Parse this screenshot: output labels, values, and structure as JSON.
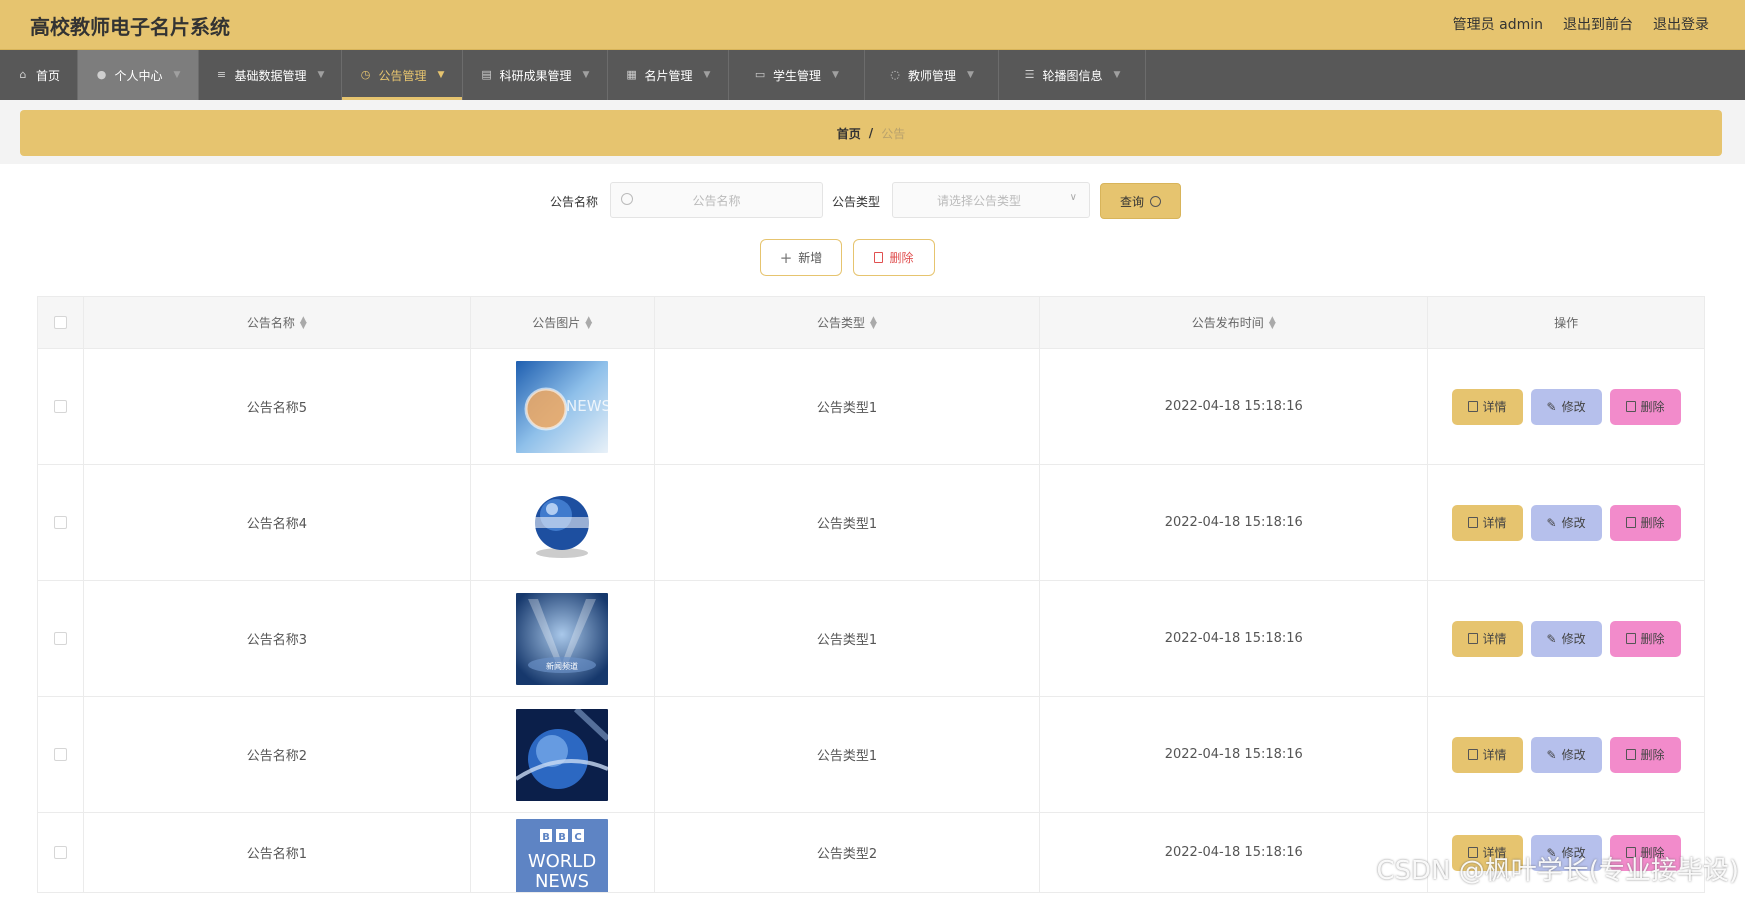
{
  "app": {
    "title": "高校教师电子名片系统"
  },
  "top_links": {
    "admin": "管理员 admin",
    "front": "退出到前台",
    "logout": "退出登录"
  },
  "nav": [
    {
      "label": "首页",
      "icon": "home-icon"
    },
    {
      "label": "个人中心",
      "icon": "user-icon"
    },
    {
      "label": "基础数据管理",
      "icon": "grid-icon"
    },
    {
      "label": "公告管理",
      "icon": "clock-icon"
    },
    {
      "label": "科研成果管理",
      "icon": "printer-icon"
    },
    {
      "label": "名片管理",
      "icon": "apps-icon"
    },
    {
      "label": "学生管理",
      "icon": "card-icon"
    },
    {
      "label": "教师管理",
      "icon": "power-icon"
    },
    {
      "label": "轮播图信息",
      "icon": "list-icon"
    }
  ],
  "breadcrumb": {
    "home": "首页",
    "sep": "/",
    "current": "公告"
  },
  "search": {
    "name_label": "公告名称",
    "name_placeholder": "公告名称",
    "type_label": "公告类型",
    "type_placeholder": "请选择公告类型",
    "query_label": "查询"
  },
  "actions": {
    "add_label": "新增",
    "delete_label": "删除"
  },
  "table": {
    "headers": [
      "公告名称",
      "公告图片",
      "公告类型",
      "公告发布时间",
      "操作"
    ],
    "rows": [
      {
        "name": "公告名称5",
        "type": "公告类型1",
        "time": "2022-04-18 15:18:16"
      },
      {
        "name": "公告名称4",
        "type": "公告类型1",
        "time": "2022-04-18 15:18:16"
      },
      {
        "name": "公告名称3",
        "type": "公告类型1",
        "time": "2022-04-18 15:18:16"
      },
      {
        "name": "公告名称2",
        "type": "公告类型1",
        "time": "2022-04-18 15:18:16"
      },
      {
        "name": "公告名称1",
        "type": "公告类型2",
        "time": "2022-04-18 15:18:16"
      }
    ],
    "ops": {
      "detail": "详情",
      "edit": "修改",
      "delete": "删除"
    },
    "thumb_text": {
      "news": "NEWS",
      "bbc": "BBC",
      "world": "WORLD",
      "news2": "NEWS",
      "studio": "新闻频道"
    }
  },
  "watermark": "CSDN @枫叶学长(专业接毕设)",
  "colors": {
    "accent": "#e6c46f",
    "nav_bg": "#585858",
    "detail_btn": "#e6c46f",
    "edit_btn": "#b6c0ec",
    "delete_btn": "#f28bcb"
  }
}
